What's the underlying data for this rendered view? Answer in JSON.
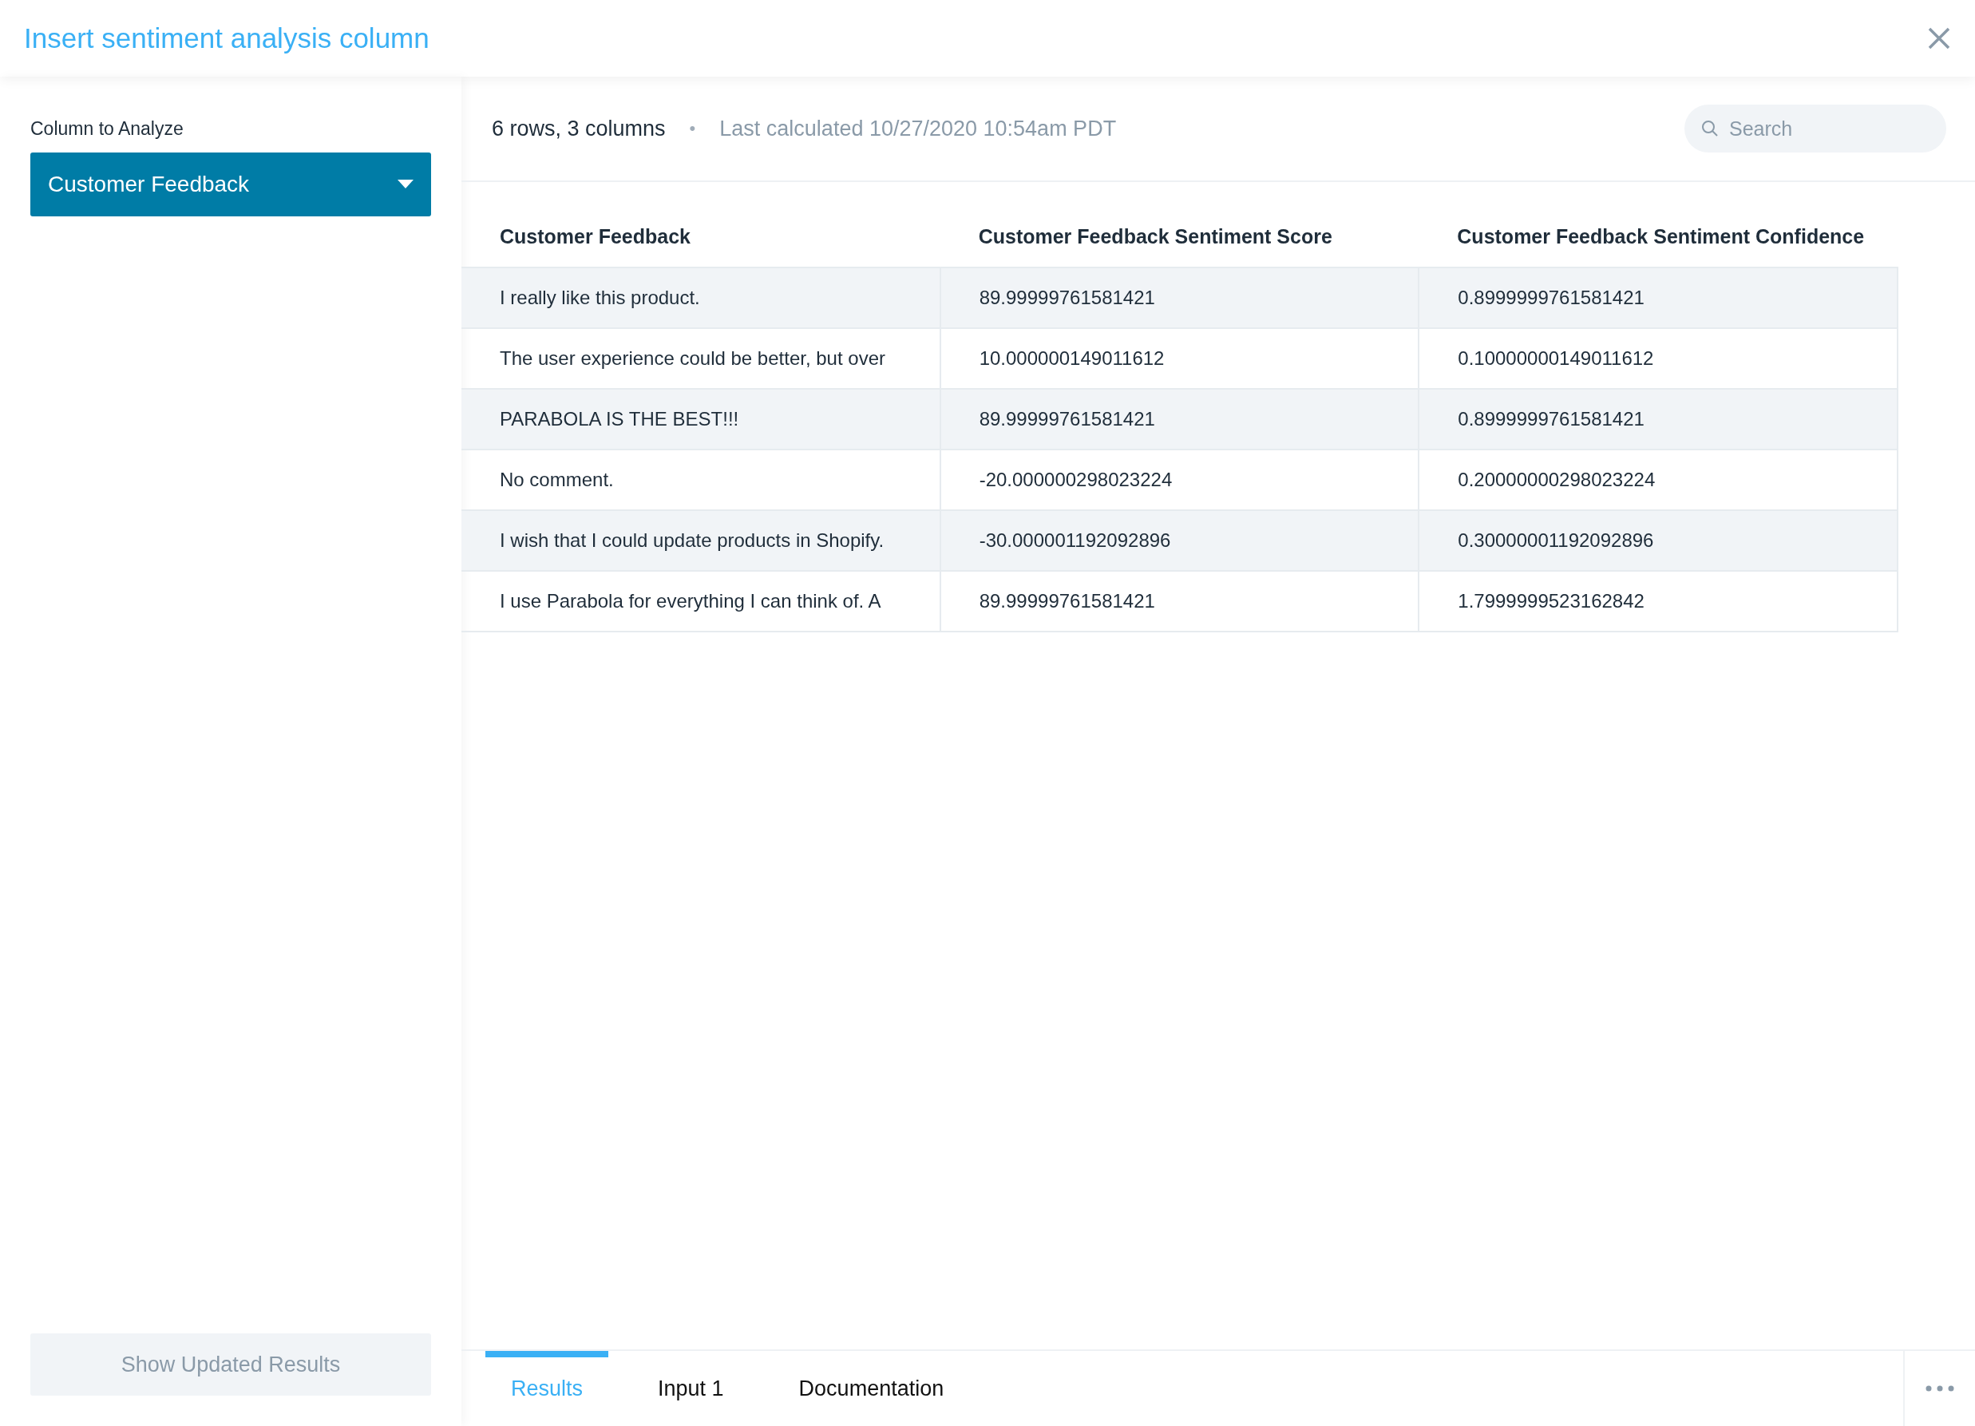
{
  "window": {
    "title": "Insert sentiment analysis column"
  },
  "sidebar": {
    "field_label": "Column to Analyze",
    "dropdown_value": "Customer Feedback",
    "button": "Show Updated Results"
  },
  "info_bar": {
    "summary": "6 rows, 3 columns",
    "separator": "•",
    "last_calculated": "Last calculated 10/27/2020 10:54am PDT"
  },
  "search": {
    "placeholder": "Search"
  },
  "table": {
    "columns": [
      "Customer Feedback",
      "Customer Feedback Sentiment Score",
      "Customer Feedback Sentiment Confidence"
    ],
    "rows": [
      [
        "I really like this product.",
        "89.99999761581421",
        "0.8999999761581421"
      ],
      [
        "The user experience could be better, but over",
        "10.000000149011612",
        "0.10000000149011612"
      ],
      [
        "PARABOLA IS THE BEST!!!",
        "89.99999761581421",
        "0.8999999761581421"
      ],
      [
        "No comment.",
        "-20.000000298023224",
        "0.20000000298023224"
      ],
      [
        "I wish that I could update products in Shopify.",
        "-30.000001192092896",
        "0.30000001192092896"
      ],
      [
        "I use Parabola for everything I can think of. A",
        "89.99999761581421",
        "1.7999999523162842"
      ]
    ]
  },
  "tabs": [
    {
      "label": "Results",
      "selected": true
    },
    {
      "label": "Input 1",
      "selected": false
    },
    {
      "label": "Documentation",
      "selected": false
    }
  ]
}
